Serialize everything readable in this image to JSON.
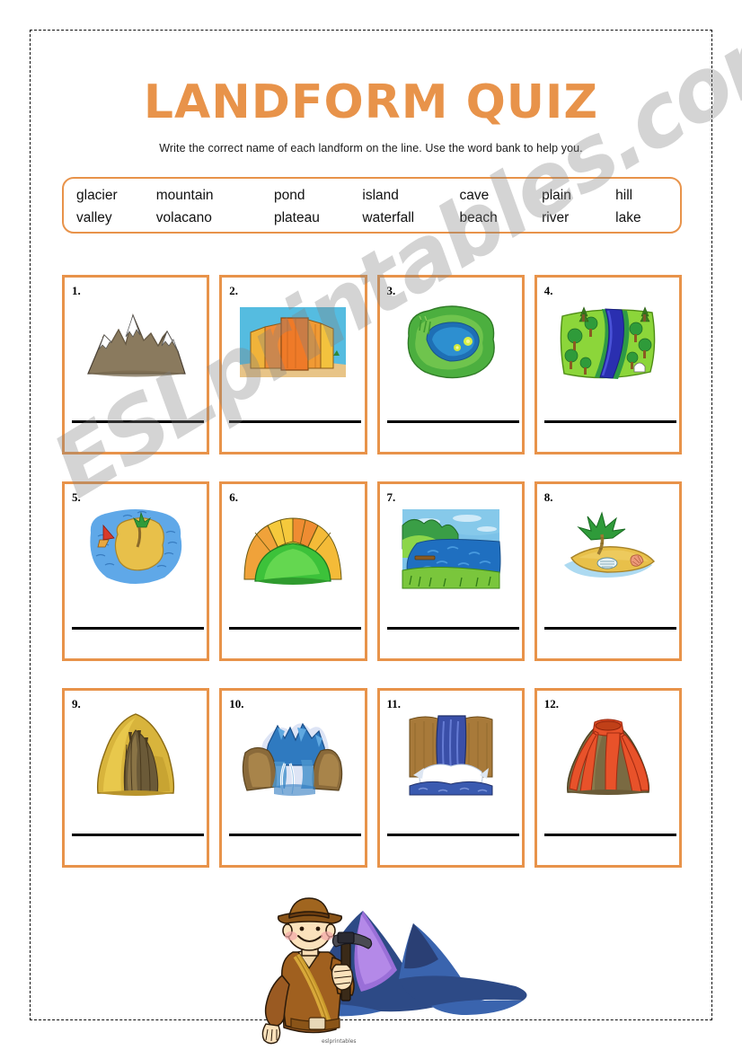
{
  "page": {
    "title": "LANDFORM QUIZ",
    "instructions": "Write the correct name of each landform on the line. Use the word bank to help you.",
    "watermark": "ESLprintables.com",
    "accent_color": "#e8934a",
    "border_color": "#e8934a",
    "line_color": "#000000"
  },
  "word_bank": {
    "rows": [
      [
        "glacier",
        "mountain",
        "pond",
        "island",
        "cave",
        "plain",
        "hill"
      ],
      [
        "valley",
        "volacano",
        "plateau",
        "waterfall",
        "beach",
        "river",
        "lake"
      ]
    ]
  },
  "items": [
    {
      "number": "1.",
      "picture": "mountain-range-icon",
      "answer_line": ""
    },
    {
      "number": "2.",
      "picture": "plateau-mesa-icon",
      "answer_line": ""
    },
    {
      "number": "3.",
      "picture": "pond-icon",
      "answer_line": ""
    },
    {
      "number": "4.",
      "picture": "river-icon",
      "answer_line": ""
    },
    {
      "number": "5.",
      "picture": "island-icon",
      "answer_line": ""
    },
    {
      "number": "6.",
      "picture": "hill-sunrise-icon",
      "answer_line": ""
    },
    {
      "number": "7.",
      "picture": "lake-icon",
      "answer_line": ""
    },
    {
      "number": "8.",
      "picture": "beach-icon",
      "answer_line": ""
    },
    {
      "number": "9.",
      "picture": "cave-icon",
      "answer_line": ""
    },
    {
      "number": "10.",
      "picture": "glacier-icon",
      "answer_line": ""
    },
    {
      "number": "11.",
      "picture": "waterfall-icon",
      "answer_line": ""
    },
    {
      "number": "12.",
      "picture": "volcano-icon",
      "answer_line": ""
    }
  ],
  "bottom_illustration": {
    "name": "explorer-with-pickaxe-and-mountains-illustration",
    "caption": "eslprintables"
  }
}
